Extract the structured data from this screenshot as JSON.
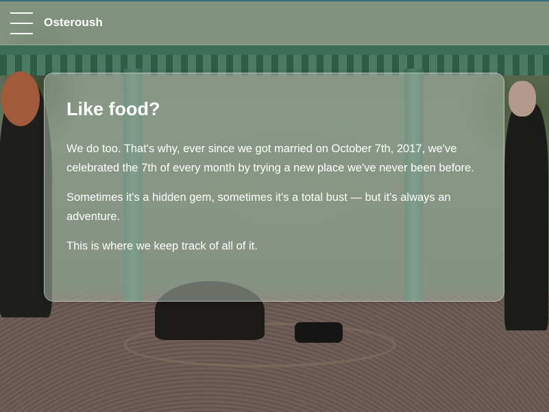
{
  "app_bar": {
    "title": "Osteroush",
    "menu_icon": "hamburger-menu-icon"
  },
  "card": {
    "heading": "Like food?",
    "paragraphs": [
      "We do too. That's why, ever since we got married on October 7th, 2017, we've celebrated the 7th of every month by trying a new place we've never been before.",
      "Sometimes it's a hidden gem, sometimes it's a total bust — but it's always an adventure.",
      "This is where we keep track of all of it."
    ]
  },
  "colors": {
    "accent_top_border": "#2d6c7a",
    "text": "#ffffff"
  }
}
